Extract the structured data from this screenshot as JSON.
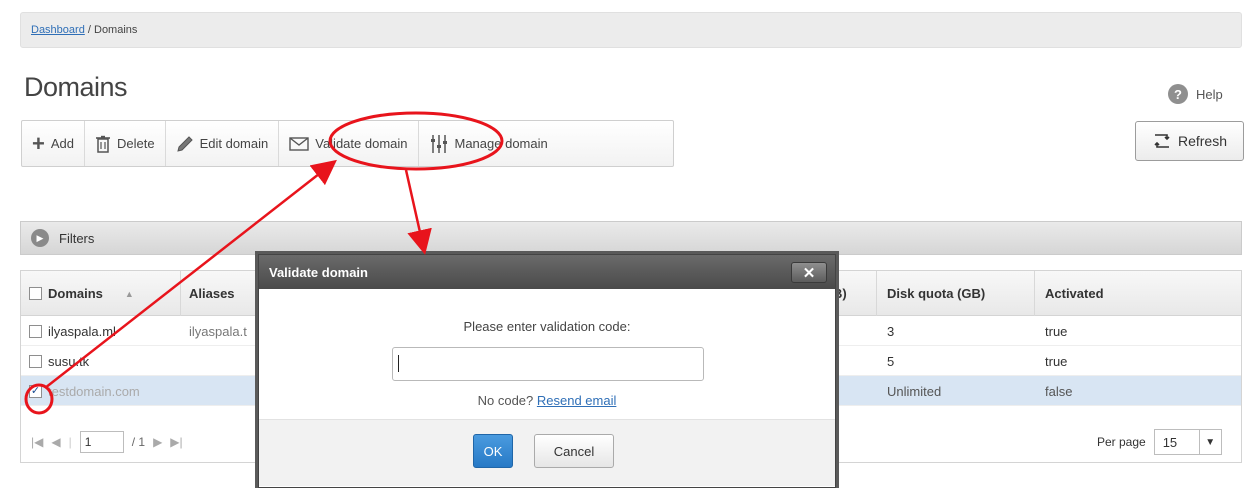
{
  "breadcrumb": {
    "link": "Dashboard",
    "separator": " / ",
    "current": "Domains"
  },
  "page_title": "Domains",
  "help_label": "Help",
  "refresh_label": "Refresh",
  "toolbar": {
    "add": "Add",
    "delete": "Delete",
    "edit": "Edit domain",
    "validate": "Validate domain",
    "manage": "Manage domain"
  },
  "filters_label": "Filters",
  "table": {
    "columns": [
      "Domains",
      "Aliases",
      "B)",
      "Disk quota (GB)",
      "Activated"
    ],
    "rows": [
      {
        "domain": "ilyaspala.ml",
        "aliases": "ilyaspala.t",
        "quota": "3",
        "activated": "true",
        "checked": false
      },
      {
        "domain": "susu.tk",
        "aliases": "",
        "quota": "5",
        "activated": "true",
        "checked": false
      },
      {
        "domain": "testdomain.com",
        "aliases": "",
        "quota": "Unlimited",
        "activated": "false",
        "checked": true
      }
    ],
    "pager": {
      "page": "1",
      "total": "/ 1"
    },
    "per_page_label": "Per page",
    "per_page_value": "15"
  },
  "modal": {
    "title": "Validate domain",
    "close": "✕",
    "prompt": "Please enter validation code:",
    "input_value": "",
    "no_code": "No code?",
    "resend": "Resend email",
    "ok": "OK",
    "cancel": "Cancel"
  },
  "colors": {
    "annotation": "#e8141c",
    "accent": "#2779c6"
  }
}
